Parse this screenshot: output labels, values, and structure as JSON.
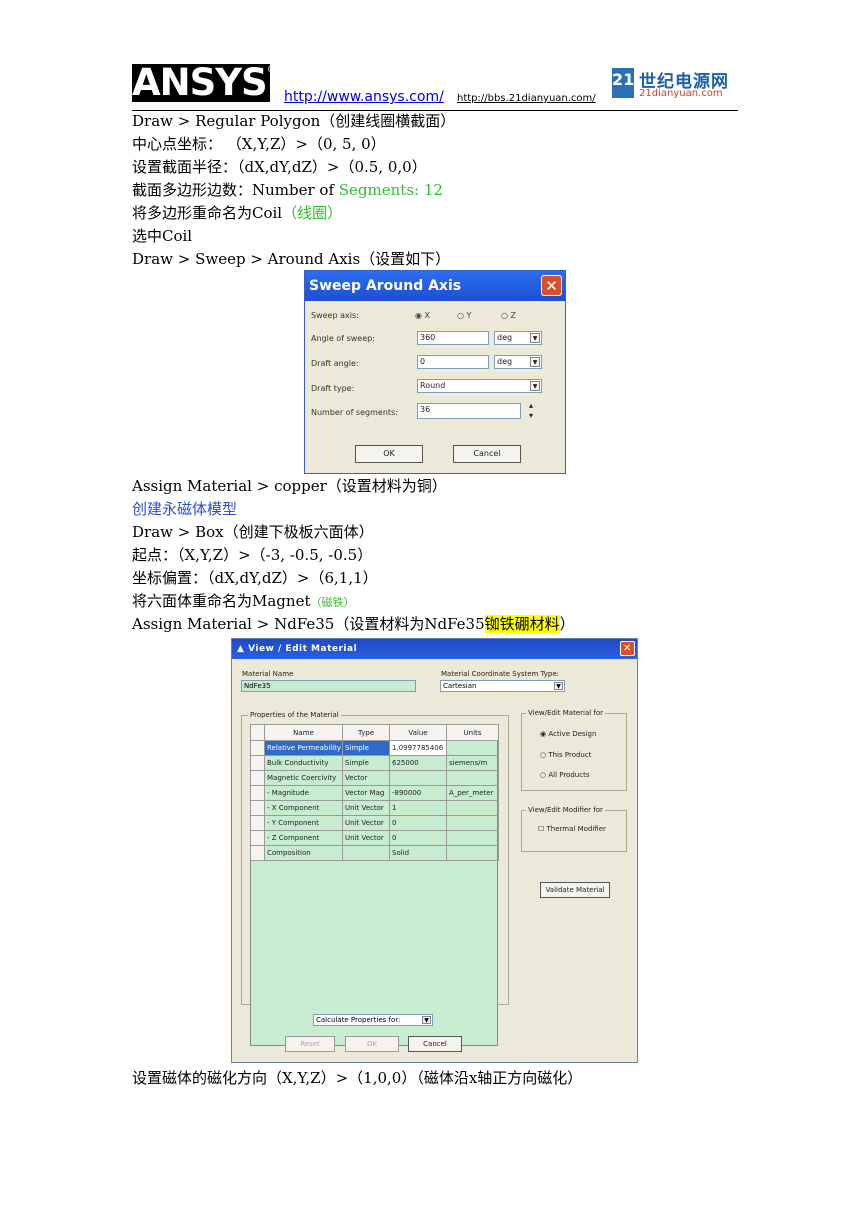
{
  "header": {
    "logo_text": "ANSYS",
    "logo_mark": "®",
    "link1": "http://www.ansys.com/",
    "link2": "http://bbs.21dianyuan.com/",
    "logo21_num": "21",
    "logo21_cn": "世纪电源网",
    "logo21_en": "21dianyuan.com"
  },
  "lines": {
    "l1": "Draw > Regular Polygon（创建线圈横截面）",
    "l2": "中心点坐标：   （X,Y,Z）>（0, 5, 0）",
    "l3": "设置截面半径：（dX,dY,dZ）>（0.5, 0,0）",
    "l4a": "截面多边形边数：Number of ",
    "l4b": "Segments: 12",
    "l5a": "将多边形重命名为Coil",
    "l5b": "（线圈）",
    "l6": "选中Coil",
    "l7": "Draw > Sweep > Around Axis（设置如下）",
    "l8": "Assign Material > copper（设置材料为铜）",
    "l9": "创建永磁体模型",
    "l10": "Draw > Box（创建下极板六面体）",
    "l11": "起点：（X,Y,Z）>（-3, -0.5, -0.5）",
    "l12": "坐标偏置：（dX,dY,dZ）>（6,1,1）",
    "l13a": "将六面体重命名为Magnet",
    "l13b": "（磁铁）",
    "l14a": "Assign Material > NdFe35（设置材料为NdFe35",
    "l14b": "铷铁硼材料",
    "l14c": "）",
    "l15": "设置磁体的磁化方向（X,Y,Z）>（1,0,0）（磁体沿x轴正方向磁化）"
  },
  "sweep_dialog": {
    "title": "Sweep Around Axis",
    "close": "✕",
    "axis_label": "Sweep axis:",
    "axis_x": "X",
    "axis_y": "Y",
    "axis_z": "Z",
    "angle_label": "Angle of sweep:",
    "angle_value": "360",
    "angle_unit": "deg",
    "draft_label": "Draft angle:",
    "draft_value": "0",
    "draft_unit": "deg",
    "drafttype_label": "Draft type:",
    "drafttype_value": "Round",
    "segments_label": "Number of segments:",
    "segments_value": "36",
    "ok": "OK",
    "cancel": "Cancel"
  },
  "material_dialog": {
    "title": "View / Edit Material",
    "close": "✕",
    "name_label": "Material Name",
    "name_value": "NdFe35",
    "coord_label": "Material Coordinate System Type:",
    "coord_value": "Cartesian",
    "props_title": "Properties of the Material",
    "columns": [
      "Name",
      "Type",
      "Value",
      "Units"
    ],
    "rows": [
      {
        "name": "Relative Permeability",
        "type": "Simple",
        "value": "1.0997785406",
        "units": ""
      },
      {
        "name": "Bulk Conductivity",
        "type": "Simple",
        "value": "625000",
        "units": "siemens/m"
      },
      {
        "name": "Magnetic Coercivity",
        "type": "Vector",
        "value": "",
        "units": ""
      },
      {
        "name": "- Magnitude",
        "type": "Vector Mag",
        "value": "-890000",
        "units": "A_per_meter"
      },
      {
        "name": "- X Component",
        "type": "Unit Vector",
        "value": "1",
        "units": ""
      },
      {
        "name": "- Y Component",
        "type": "Unit Vector",
        "value": "0",
        "units": ""
      },
      {
        "name": "- Z Component",
        "type": "Unit Vector",
        "value": "0",
        "units": ""
      },
      {
        "name": "Composition",
        "type": "",
        "value": "Solid",
        "units": ""
      }
    ],
    "view_for_title": "View/Edit Material for",
    "opt_active": "Active Design",
    "opt_product": "This Product",
    "opt_all": "All Products",
    "modifier_title": "View/Edit Modifier for",
    "thermal": "Thermal Modifier",
    "validate": "Validate Material",
    "calc": "Calculate Properties for:",
    "reset": "Reset",
    "ok": "OK",
    "cancel": "Cancel"
  }
}
